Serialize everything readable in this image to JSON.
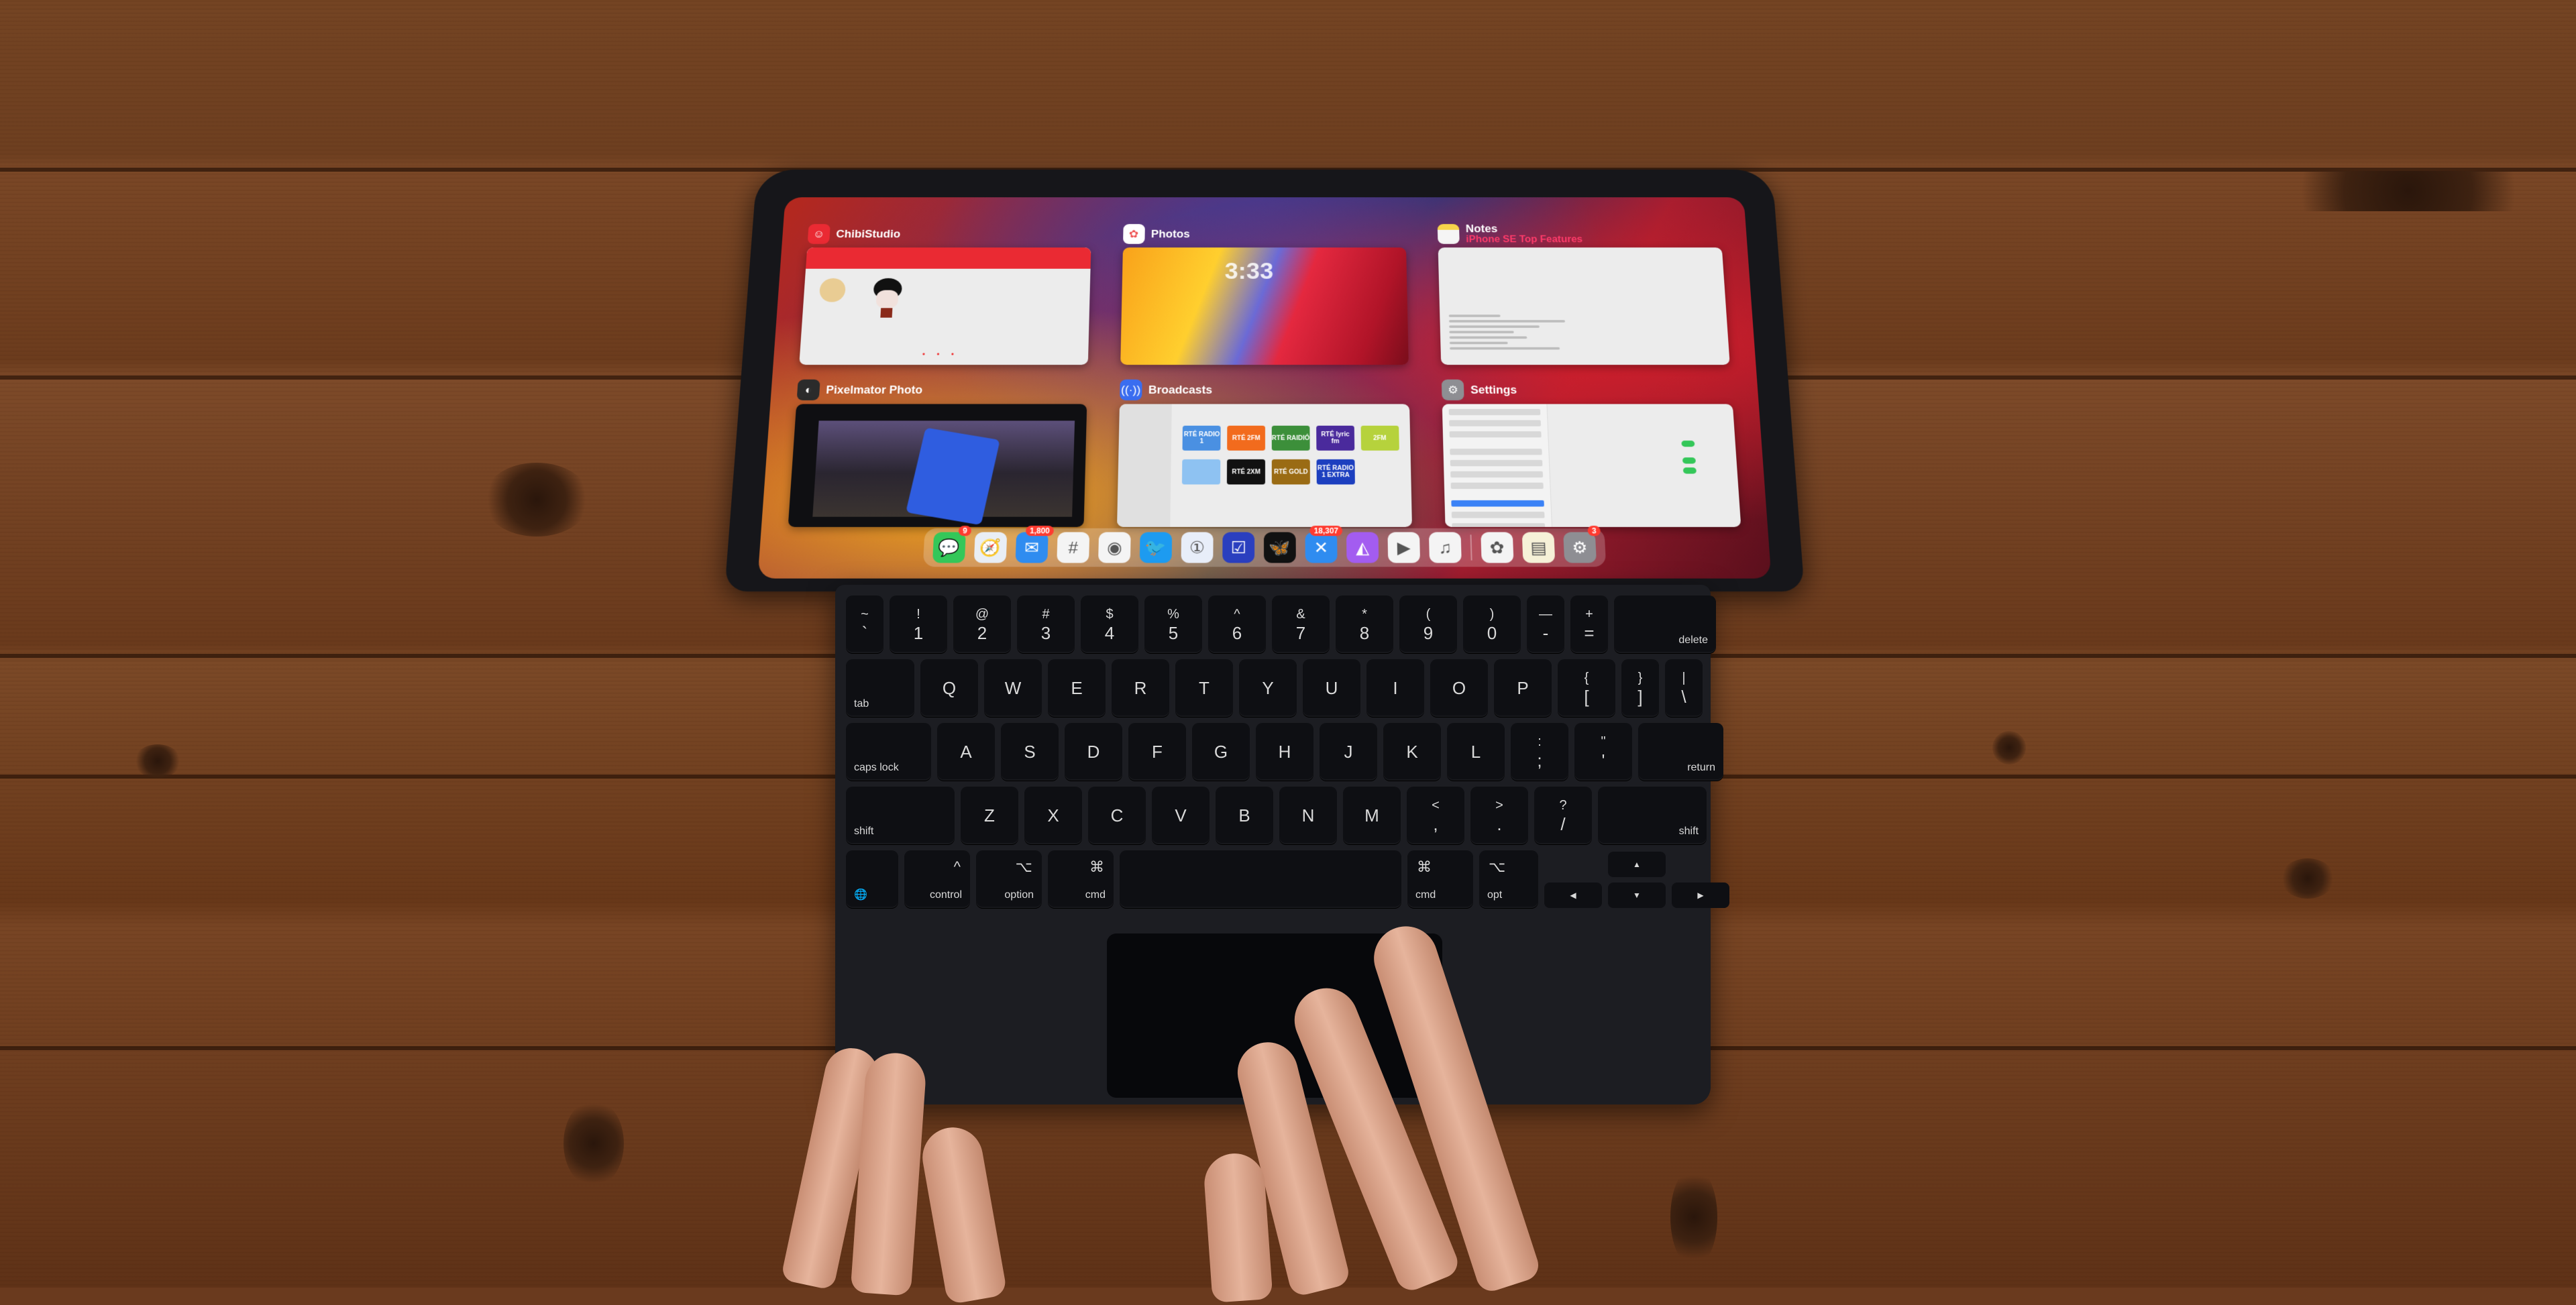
{
  "scene": {
    "description": "iPad Pro on Magic Keyboard showing App Switcher",
    "colors": {
      "wood": "#6e3f20",
      "keyboard": "#1c1d22",
      "key": "#0e0f13",
      "badge": "#ff3b30"
    }
  },
  "app_switcher": {
    "cards": [
      {
        "app": "ChibiStudio",
        "icon": "chibistudio-icon",
        "icon_color": "#ea2a33"
      },
      {
        "app": "Photos",
        "icon": "photos-icon",
        "icon_color": "#ffffff",
        "lock_time": "3:33"
      },
      {
        "app": "Notes",
        "subtitle": "iPhone SE Top Features",
        "icon": "notes-icon",
        "icon_color": "#f6d34a"
      },
      {
        "app": "Pixelmator Photo",
        "icon": "pixelmator-icon",
        "icon_color": "#2b2b2b"
      },
      {
        "app": "Broadcasts",
        "icon": "broadcasts-icon",
        "icon_color": "#3a6df0",
        "stations": [
          {
            "label": "RTÉ RADIO 1",
            "color": "#4a90e2"
          },
          {
            "label": "RTÉ 2FM",
            "color": "#f26b1d"
          },
          {
            "label": "RTÉ RAIDIÓ",
            "color": "#3c8f3a"
          },
          {
            "label": "RTÉ lyric fm",
            "color": "#4a2a9c"
          },
          {
            "label": "2FM",
            "color": "#b6d23c"
          },
          {
            "label": "",
            "color": "#8ec2f2"
          },
          {
            "label": "RTÉ 2XM",
            "color": "#111111"
          },
          {
            "label": "RTÉ GOLD",
            "color": "#9a6b14"
          },
          {
            "label": "RTÉ RADIO 1 EXTRA",
            "color": "#1c3fbf"
          }
        ]
      },
      {
        "app": "Settings",
        "icon": "settings-icon",
        "icon_color": "#8e8e93"
      }
    ]
  },
  "dock": {
    "apps": [
      {
        "name": "Messages",
        "icon": "messages-icon",
        "glyph": "💬",
        "bg": "#34c759",
        "badge": "9"
      },
      {
        "name": "Safari",
        "icon": "safari-icon",
        "glyph": "🧭",
        "bg": "#e9eef5",
        "badge": null
      },
      {
        "name": "Mail",
        "icon": "mail-icon",
        "glyph": "✉",
        "bg": "#2f8cf0",
        "badge": "1,800"
      },
      {
        "name": "Slack",
        "icon": "slack-icon",
        "glyph": "#",
        "bg": "#f4f4f4",
        "badge": null
      },
      {
        "name": "Apollo",
        "icon": "apollo-icon",
        "glyph": "◉",
        "bg": "#f4f4f4",
        "badge": null
      },
      {
        "name": "Twitter",
        "icon": "twitter-icon",
        "glyph": "🐦",
        "bg": "#1d9bf0",
        "badge": null
      },
      {
        "name": "1Password",
        "icon": "onepassword-icon",
        "glyph": "①",
        "bg": "#e8eef9",
        "badge": null
      },
      {
        "name": "OmniFocus",
        "icon": "checkbox-icon",
        "glyph": "☑",
        "bg": "#2a3fbf",
        "badge": null
      },
      {
        "name": "Tes",
        "icon": "butterfly-icon",
        "glyph": "🦋",
        "bg": "#111111",
        "badge": null
      },
      {
        "name": "Tweetbot",
        "icon": "tweetbot-icon",
        "glyph": "✕",
        "bg": "#2f8cf0",
        "badge": "18,307"
      },
      {
        "name": "Affinity Photo",
        "icon": "affinity-icon",
        "glyph": "◭",
        "bg": "#a35cf0",
        "badge": null
      },
      {
        "name": "YouTube Studio",
        "icon": "youtube-studio-icon",
        "glyph": "▶",
        "bg": "#f4f4f4",
        "badge": null
      },
      {
        "name": "Music",
        "icon": "music-icon",
        "glyph": "♫",
        "bg": "#f4f4f4",
        "badge": null
      }
    ],
    "recent_apps": [
      {
        "name": "Photos",
        "icon": "photos-icon",
        "glyph": "✿",
        "bg": "#f4f4f4",
        "badge": null
      },
      {
        "name": "Notes",
        "icon": "notes-icon",
        "glyph": "▤",
        "bg": "#f6f1d8",
        "badge": null
      },
      {
        "name": "Settings",
        "icon": "settings-icon",
        "glyph": "⚙",
        "bg": "#8e8e93",
        "badge": "3"
      }
    ]
  },
  "keyboard": {
    "rows": [
      [
        {
          "t": "~",
          "b": "`",
          "n": true
        },
        {
          "t": "!",
          "b": "1"
        },
        {
          "t": "@",
          "b": "2"
        },
        {
          "t": "#",
          "b": "3"
        },
        {
          "t": "$",
          "b": "4"
        },
        {
          "t": "%",
          "b": "5"
        },
        {
          "t": "^",
          "b": "6"
        },
        {
          "t": "&",
          "b": "7"
        },
        {
          "t": "*",
          "b": "8"
        },
        {
          "t": "(",
          "b": "9"
        },
        {
          "t": ")",
          "b": "0"
        },
        {
          "t": "—",
          "b": "-",
          "n": true
        },
        {
          "t": "+",
          "b": "=",
          "n": true
        },
        {
          "m": "delete",
          "w": 140,
          "a": "r"
        }
      ],
      [
        {
          "m": "tab",
          "w": 90,
          "a": "l"
        },
        {
          "b": "Q"
        },
        {
          "b": "W"
        },
        {
          "b": "E"
        },
        {
          "b": "R"
        },
        {
          "b": "T"
        },
        {
          "b": "Y"
        },
        {
          "b": "U"
        },
        {
          "b": "I"
        },
        {
          "b": "O"
        },
        {
          "b": "P"
        },
        {
          "t": "{",
          "b": "["
        },
        {
          "t": "}",
          "b": "]",
          "n": true
        },
        {
          "t": "|",
          "b": "\\",
          "n": true
        }
      ],
      [
        {
          "m": "caps lock",
          "w": 115,
          "a": "l"
        },
        {
          "b": "A"
        },
        {
          "b": "S"
        },
        {
          "b": "D"
        },
        {
          "b": "F"
        },
        {
          "b": "G"
        },
        {
          "b": "H"
        },
        {
          "b": "J"
        },
        {
          "b": "K"
        },
        {
          "b": "L"
        },
        {
          "t": ":",
          "b": ";"
        },
        {
          "t": "\"",
          "b": "'"
        },
        {
          "m": "return",
          "w": 115,
          "a": "r"
        }
      ],
      [
        {
          "m": "shift",
          "w": 150,
          "a": "l"
        },
        {
          "b": "Z"
        },
        {
          "b": "X"
        },
        {
          "b": "C"
        },
        {
          "b": "V"
        },
        {
          "b": "B"
        },
        {
          "b": "N"
        },
        {
          "b": "M"
        },
        {
          "t": "<",
          "b": ","
        },
        {
          "t": ">",
          "b": "."
        },
        {
          "t": "?",
          "b": "/"
        },
        {
          "m": "shift",
          "w": 150,
          "a": "r"
        }
      ]
    ],
    "bottom_row": {
      "globe": "🌐",
      "control": {
        "label": "control",
        "symbol": "^"
      },
      "option": {
        "label": "option",
        "symbol": "⌥"
      },
      "cmd_left": {
        "label": "cmd",
        "symbol": "⌘"
      },
      "cmd_right": {
        "label": "cmd",
        "symbol": "⌘"
      },
      "opt_right": {
        "label": "opt",
        "symbol": "⌥"
      },
      "arrows": {
        "up": "▲",
        "down": "▼",
        "left": "◀",
        "right": "▶"
      }
    }
  }
}
